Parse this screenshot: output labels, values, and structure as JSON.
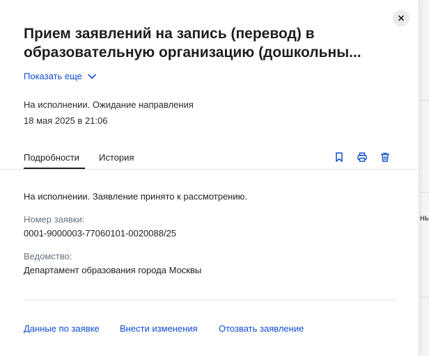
{
  "modal": {
    "title": "Прием заявлений на запись (перевод) в образовательную организацию (дошкольны...",
    "show_more_label": "Показать еще",
    "status_line": "На исполнении. Ожидание направления",
    "date_line": "18 мая 2025 в 21:06",
    "tabs": [
      {
        "label": "Подробности",
        "active": true
      },
      {
        "label": "История",
        "active": false
      }
    ],
    "toolbar_icons": [
      "bookmark-icon",
      "print-icon",
      "trash-icon"
    ],
    "details": {
      "message": "На исполнении. Заявление принято к рассмотрению.",
      "request_number_label": "Номер заявки:",
      "request_number_value": "0001-9000003-77060101-0020088/25",
      "department_label": "Ведомство:",
      "department_value": "Департамент образования города Москвы"
    },
    "actions": [
      {
        "label": "Данные по заявке"
      },
      {
        "label": "Внести изменения"
      },
      {
        "label": "Отозвать заявление"
      }
    ]
  },
  "background": {
    "peek_text": "нь"
  },
  "colors": {
    "link": "#0d4cd3",
    "text": "#1f1f1f",
    "muted": "#66727f",
    "close_bg": "#e9ebee"
  }
}
